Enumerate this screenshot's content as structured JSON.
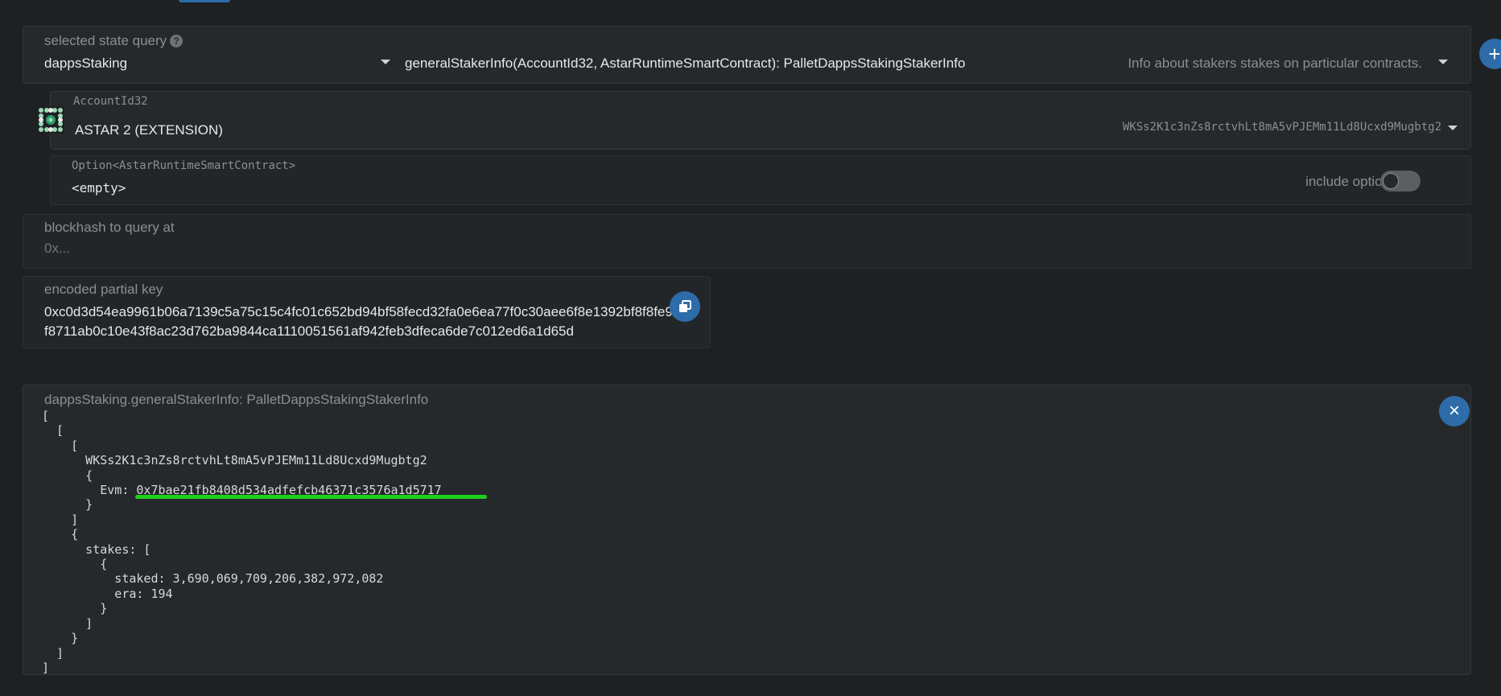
{
  "query": {
    "label": "selected state query",
    "help_icon": "?",
    "module": "dappsStaking",
    "method": "generalStakerInfo(AccountId32, AstarRuntimeSmartContract): PalletDappsStakingStakerInfo",
    "description": "Info about stakers stakes on particular contracts."
  },
  "account": {
    "label": "AccountId32",
    "name": "ASTAR 2 (EXTENSION)",
    "address": "WKSs2K1c3nZs8rctvhLt8mA5vPJEMm11Ld8Ucxd9Mugbtg2"
  },
  "option": {
    "label": "Option<AstarRuntimeSmartContract>",
    "value": "<empty>",
    "toggle_label": "include option",
    "toggle_on": false
  },
  "blockhash": {
    "label": "blockhash to query at",
    "placeholder": "0x..."
  },
  "partial_key": {
    "label": "encoded partial key",
    "line1": "0xc0d3d54ea9961b06a7139c5a75c15c4fc01c652bd94bf58fecd32fa0e6ea77f0c30aee6f8e1392bf8f8fe9",
    "line2": "f8711ab0c10e43f8ac23d762ba9844ca1110051561af942feb3dfeca6de7c012ed6a1d65d"
  },
  "result": {
    "title": "dappsStaking.generalStakerInfo: PalletDappsStakingStakerInfo",
    "code": "[\n  [\n    [\n      WKSs2K1c3nZs8rctvhLt8mA5vPJEMm11Ld8Ucxd9Mugbtg2\n      {\n        Evm: 0x7bae21fb8408d534adfefcb46371c3576a1d5717\n      }\n    ]\n    {\n      stakes: [\n        {\n          staked: 3,690,069,709,206,382,972,082\n          era: 194\n        }\n      ]\n    }\n  ]\n]"
  },
  "buttons": {
    "add": "+",
    "close": "×"
  },
  "colors": {
    "accent": "#2d6ca8",
    "highlight": "#1fcf1f",
    "background": "#1e2022",
    "panel": "#26292b"
  }
}
